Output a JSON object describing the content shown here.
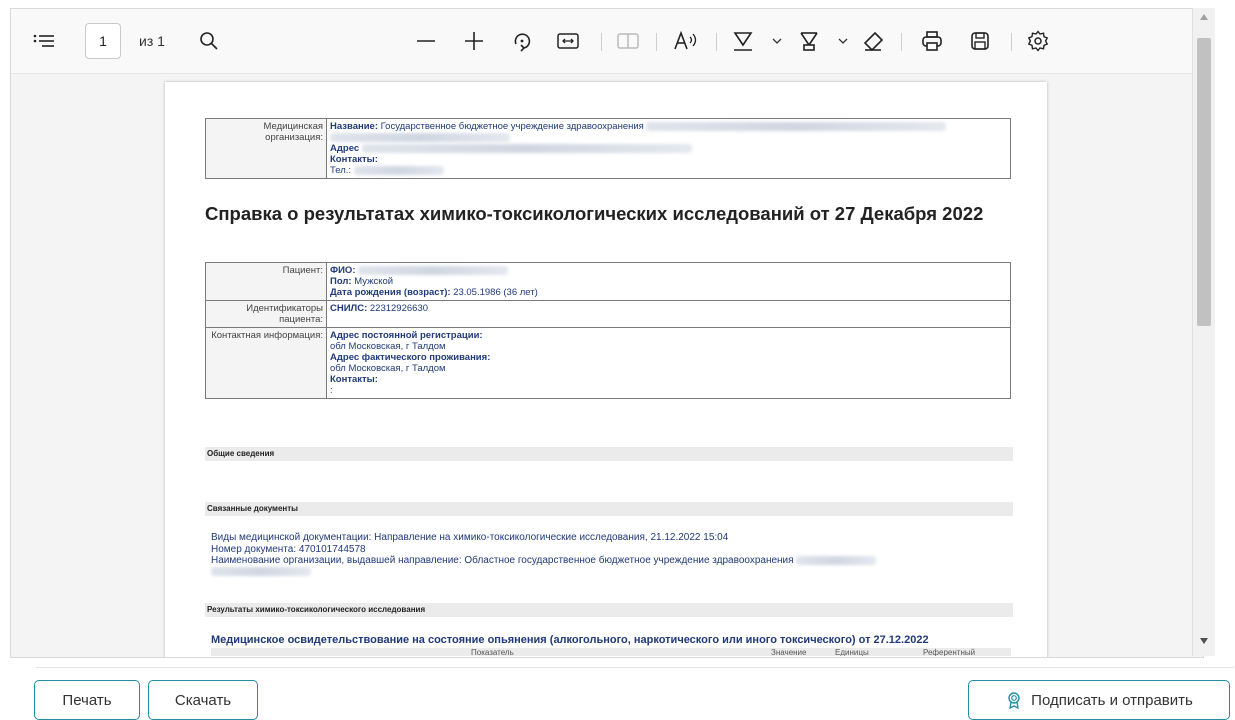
{
  "toolbar": {
    "page_current": "1",
    "page_of": "из 1",
    "icons": [
      "outline-icon",
      "search-icon",
      "zoom-out-icon",
      "zoom-in-icon",
      "rotate-icon",
      "fit-width-icon",
      "two-page-icon",
      "read-aloud-icon",
      "highlight-icon",
      "draw-icon",
      "erase-icon",
      "print-icon",
      "save-icon",
      "settings-icon"
    ]
  },
  "document": {
    "org_label": "Медицинская организация:",
    "org_name_label": "Название:",
    "org_name_value": "Государственное бюджетное учреждение здравоохранения",
    "org_address_label": "Адрес",
    "org_contacts_label": "Контакты:",
    "org_phone_label": "Тел.:",
    "title": "Справка о результатах химико-токсикологических исследований от 27 Декабря 2022",
    "patient_label": "Пациент:",
    "fio_label": "ФИО:",
    "sex_label": "Пол:",
    "sex_value": "Мужской",
    "dob_label": "Дата рождения (возраст):",
    "dob_value": "23.05.1986 (36 лет)",
    "ids_label": "Идентификаторы пациента:",
    "snils_label": "СНИЛС:",
    "snils_value": "22312926630",
    "contact_label": "Контактная информация:",
    "reg_address_label": "Адрес постоянной регистрации:",
    "reg_address_value": "обл Московская, г Талдом",
    "fact_address_label": "Адрес фактического проживания:",
    "fact_address_value": "обл Московская, г Талдом",
    "contacts_label": "Контакты:",
    "contacts_value": ":",
    "section_general": "Общие сведения",
    "section_related": "Связанные документы",
    "related_line1": "Виды медицинской документации: Направление на химико-токсикологические исследования, 21.12.2022 15:04",
    "related_line2": "Номер документа: 470101744578",
    "related_line3": "Наименование организации, выдавшей направление: Областное государственное бюджетное учреждение здравоохранения",
    "section_results": "Результаты химико-токсикологического исследования",
    "result_title": "Медицинское освидетельствование на состояние опьянения (алкогольного, наркотического или иного токсического) от 27.12.2022",
    "result_head_indicator": "Показатель",
    "result_head_value": "Значение",
    "result_head_units": "Единицы",
    "result_head_ref": "Референтный"
  },
  "footer": {
    "print_label": "Печать",
    "download_label": "Скачать",
    "sign_label": "Подписать и отправить"
  }
}
